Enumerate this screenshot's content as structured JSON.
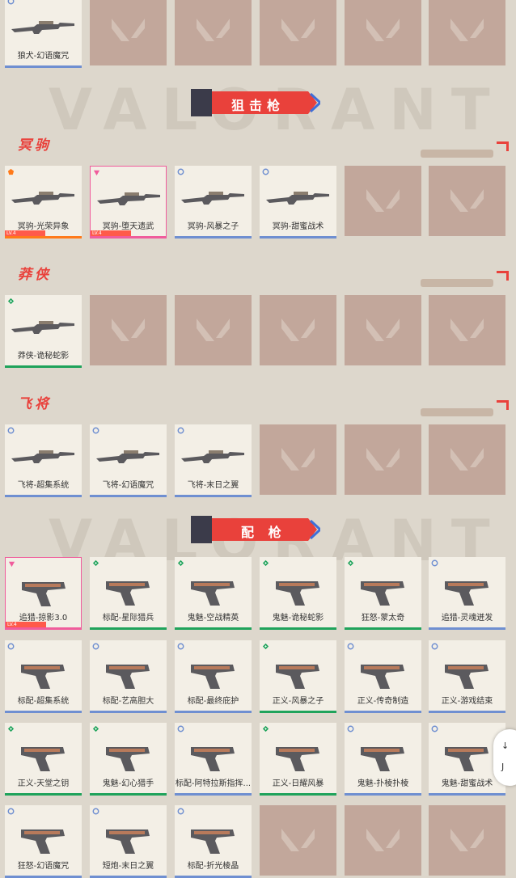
{
  "watermark": "VALORANT",
  "top_row": {
    "items": [
      {
        "name": "狼犬-幻语魔咒",
        "tier": "blue"
      }
    ],
    "empty_count": 5
  },
  "banners": [
    {
      "label": "狙击枪"
    },
    {
      "label": "配 枪"
    }
  ],
  "sections": [
    {
      "title": "冥驹",
      "items": [
        {
          "name": "冥驹-光荣异象",
          "tier": "orange",
          "lv": "LV.4"
        },
        {
          "name": "冥驹-堕天遗武",
          "tier": "pink",
          "lv": "LV.4"
        },
        {
          "name": "冥驹-风暴之子",
          "tier": "blue"
        },
        {
          "name": "冥驹-甜蜜战术",
          "tier": "blue"
        }
      ],
      "empty_count": 2
    },
    {
      "title": "莽侠",
      "items": [
        {
          "name": "莽侠-诡秘蛇影",
          "tier": "green"
        }
      ],
      "empty_count": 5
    },
    {
      "title": "飞将",
      "items": [
        {
          "name": "飞将-超集系统",
          "tier": "blue"
        },
        {
          "name": "飞将-幻语魔咒",
          "tier": "blue"
        },
        {
          "name": "飞将-末日之翼",
          "tier": "blue"
        }
      ],
      "empty_count": 3
    }
  ],
  "pistols": [
    {
      "name": "追猎-掠影3.0",
      "tier": "pink",
      "lv": "LV.4"
    },
    {
      "name": "标配-星际猎兵",
      "tier": "green"
    },
    {
      "name": "鬼魅-空战精英",
      "tier": "green"
    },
    {
      "name": "鬼魅-诡秘蛇影",
      "tier": "green"
    },
    {
      "name": "狂怒-蒙太奇",
      "tier": "green"
    },
    {
      "name": "追猎-灵魂迸发",
      "tier": "blue"
    },
    {
      "name": "标配-超集系统",
      "tier": "blue"
    },
    {
      "name": "标配-艺高胆大",
      "tier": "blue"
    },
    {
      "name": "标配-最终庇护",
      "tier": "blue"
    },
    {
      "name": "正义-风暴之子",
      "tier": "green"
    },
    {
      "name": "正义-传奇制造",
      "tier": "blue"
    },
    {
      "name": "正义-游戏结束",
      "tier": "blue"
    },
    {
      "name": "正义-天堂之钥",
      "tier": "green"
    },
    {
      "name": "鬼魅-幻心猎手",
      "tier": "green"
    },
    {
      "name": "标配-阿特拉斯指挥...",
      "tier": "blue"
    },
    {
      "name": "正义-日耀风暴",
      "tier": "green"
    },
    {
      "name": "鬼魅-扑棱扑棱",
      "tier": "blue"
    },
    {
      "name": "鬼魅-甜蜜战术",
      "tier": "blue"
    },
    {
      "name": "狂怒-幻语魔咒",
      "tier": "blue"
    },
    {
      "name": "短炮-末日之翼",
      "tier": "blue"
    },
    {
      "name": "标配-折光棱晶",
      "tier": "blue"
    }
  ],
  "pistol_empty_count": 3,
  "side_button": {
    "line1": "↓",
    "line2": "J"
  },
  "colors": {
    "accent": "#e9413b",
    "blue_tier": "#6f8fd1",
    "green_tier": "#1fa35b",
    "pink_tier": "#f05c9c",
    "orange_tier": "#ff7a1a"
  }
}
